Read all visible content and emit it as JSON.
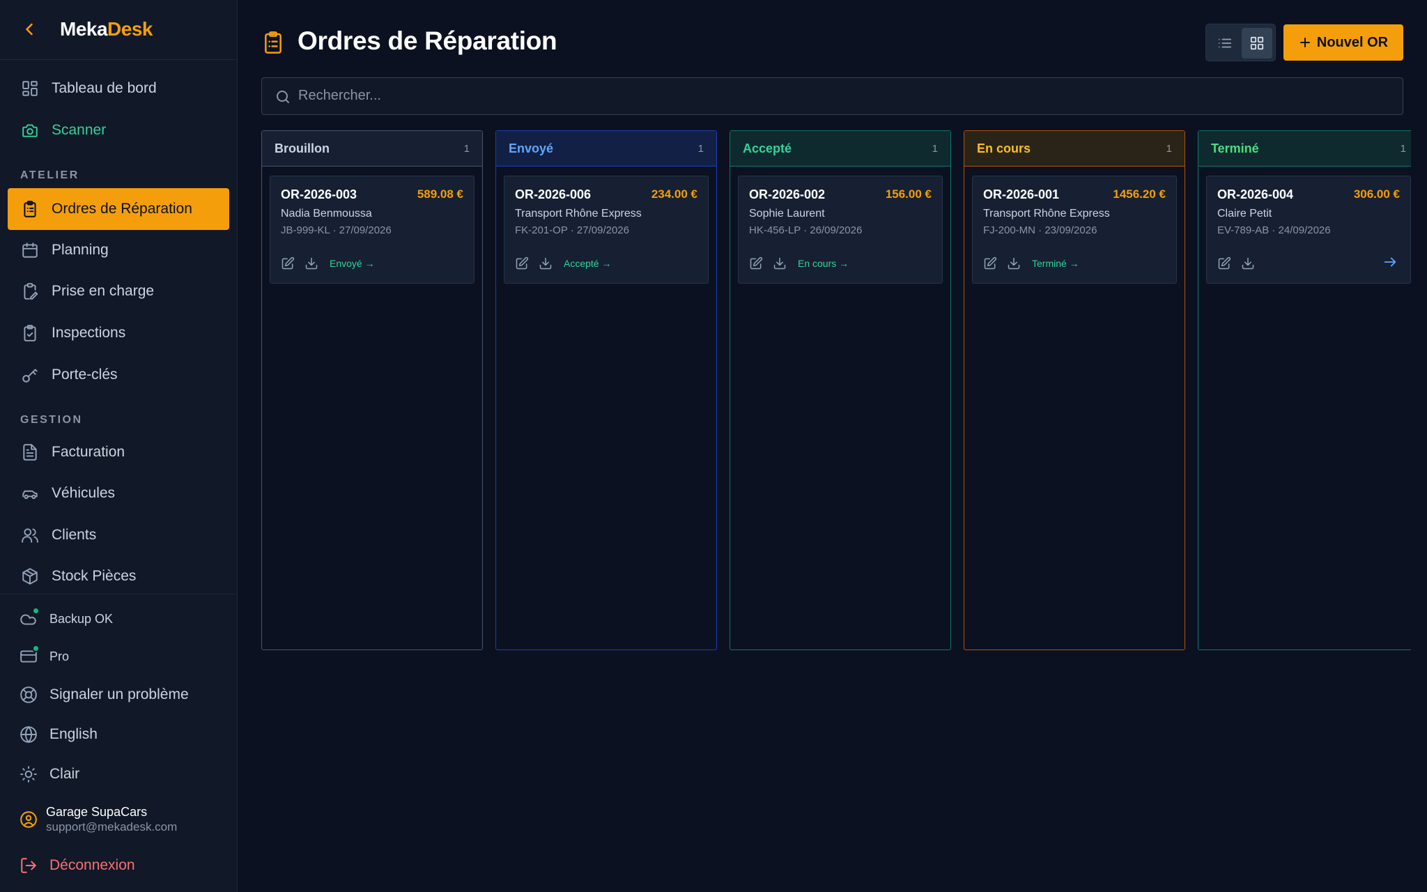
{
  "sidebar": {
    "brand_part1": "Meka",
    "brand_part2": "Desk",
    "nav_main": [
      {
        "label": "Tableau de bord",
        "icon": "dashboard-icon"
      },
      {
        "label": "Scanner",
        "icon": "camera-icon"
      }
    ],
    "section_atelier": "ATELIER",
    "nav_atelier": [
      {
        "label": "Ordres de Réparation",
        "icon": "clipboard-list-icon",
        "active": true
      },
      {
        "label": "Planning",
        "icon": "calendar-icon"
      },
      {
        "label": "Prise en charge",
        "icon": "clipboard-pen-icon"
      },
      {
        "label": "Inspections",
        "icon": "clipboard-check-icon"
      },
      {
        "label": "Porte-clés",
        "icon": "key-icon"
      }
    ],
    "section_gestion": "GESTION",
    "nav_gestion": [
      {
        "label": "Facturation",
        "icon": "file-text-icon"
      },
      {
        "label": "Véhicules",
        "icon": "car-icon"
      },
      {
        "label": "Clients",
        "icon": "users-icon"
      },
      {
        "label": "Stock Pièces",
        "icon": "package-icon"
      }
    ],
    "utilities": {
      "backup": "Backup OK",
      "plan": "Pro",
      "report": "Signaler un problème",
      "language": "English",
      "theme": "Clair"
    },
    "account": {
      "name": "Garage SupaCars",
      "email": "support@mekadesk.com"
    },
    "logout": "Déconnexion"
  },
  "header": {
    "title": "Ordres de Réparation",
    "new_button": "Nouvel OR"
  },
  "search": {
    "placeholder": "Rechercher..."
  },
  "columns": [
    {
      "title": "Brouillon",
      "count": "1",
      "card": {
        "id": "OR-2026-003",
        "amount": "589.08 €",
        "client": "Nadia Benmoussa",
        "meta": "JB-999-KL · 27/09/2026",
        "next": "Envoyé →"
      }
    },
    {
      "title": "Envoyé",
      "count": "1",
      "card": {
        "id": "OR-2026-006",
        "amount": "234.00 €",
        "client": "Transport Rhône Express",
        "meta": "FK-201-OP · 27/09/2026",
        "next": "Accepté →"
      }
    },
    {
      "title": "Accepté",
      "count": "1",
      "card": {
        "id": "OR-2026-002",
        "amount": "156.00 €",
        "client": "Sophie Laurent",
        "meta": "HK-456-LP · 26/09/2026",
        "next": "En cours →"
      }
    },
    {
      "title": "En cours",
      "count": "1",
      "card": {
        "id": "OR-2026-001",
        "amount": "1456.20 €",
        "client": "Transport Rhône Express",
        "meta": "FJ-200-MN · 23/09/2026",
        "next": "Terminé →"
      }
    },
    {
      "title": "Terminé",
      "count": "1",
      "card": {
        "id": "OR-2026-004",
        "amount": "306.00 €",
        "client": "Claire Petit",
        "meta": "EV-789-AB · 24/09/2026"
      }
    }
  ],
  "colors": {
    "accent": "#f59e0b",
    "background": "#0b1120",
    "sidebar": "#111827",
    "brouillon": "#475569",
    "envoye": "#3b82f6",
    "accepte": "#10b981",
    "en_cours": "#f59e0b",
    "termine": "#10b981",
    "danger": "#f87171"
  }
}
